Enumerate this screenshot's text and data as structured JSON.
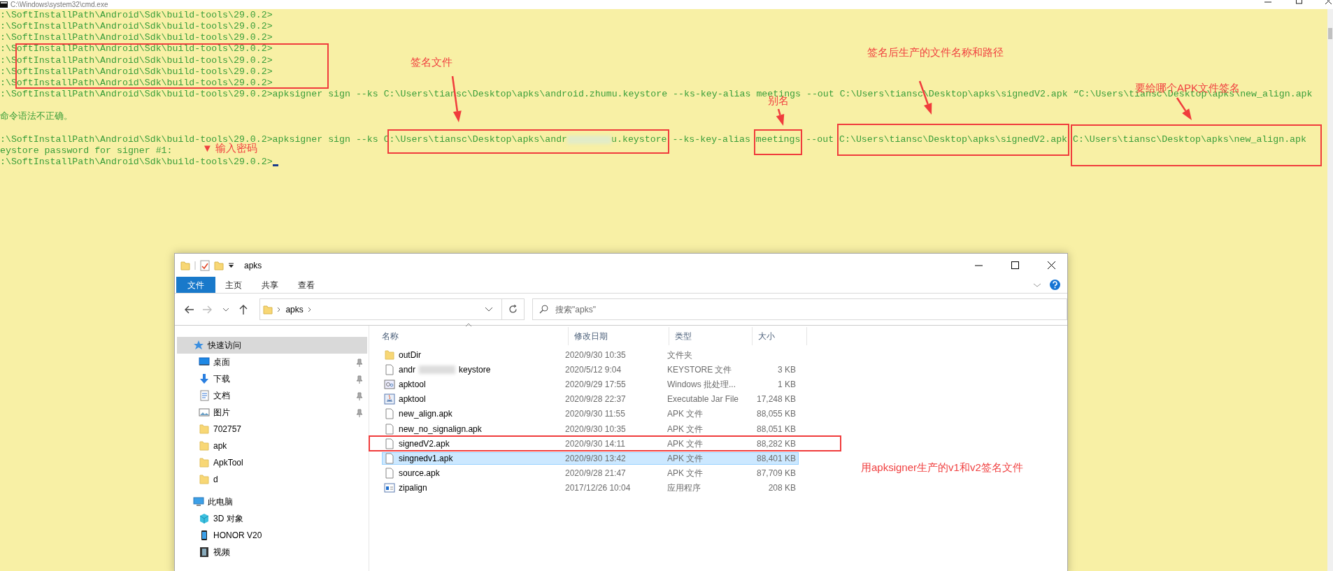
{
  "console_window": {
    "title": "C:\\Windows\\system32\\cmd.exe",
    "blocks": [
      {
        "lines": [
          {
            "text": ":\\SoftInstallPath\\Android\\Sdk\\build-tools\\29.0.2>"
          },
          {
            "text": ":\\SoftInstallPath\\Android\\Sdk\\build-tools\\29.0.2>"
          },
          {
            "text": ":\\SoftInstallPath\\Android\\Sdk\\build-tools\\29.0.2>"
          },
          {
            "text": ":\\SoftInstallPath\\Android\\Sdk\\build-tools\\29.0.2>"
          },
          {
            "text": ":\\SoftInstallPath\\Android\\Sdk\\build-tools\\29.0.2>"
          },
          {
            "text": ":\\SoftInstallPath\\Android\\Sdk\\build-tools\\29.0.2>"
          },
          {
            "text": ":\\SoftInstallPath\\Android\\Sdk\\build-tools\\29.0.2>"
          },
          {
            "text": ":\\SoftInstallPath\\Android\\Sdk\\build-tools\\29.0.2>apksigner sign --ks C:\\Users\\tiansc\\Desktop\\apks\\android.zhumu.keystore --ks-key-alias meetings --out C:\\Users\\tiansc\\Desktop\\apks\\signedV2.apk “C:\\Users\\tiansc\\Desktop\\apks\\new_align.apk"
          }
        ]
      },
      {
        "lines": [
          {
            "text": "命令语法不正确。"
          }
        ]
      },
      {
        "lines": [
          {
            "text_parts": [
              ":\\SoftInstallPath\\Android\\Sdk\\build-tools\\29.0.2>apksigner sign --ks C:\\Users\\tiansc\\Desktop\\apks\\andr",
              "u.keystore --ks-key-alias meetings --out C:\\Users\\tiansc\\Desktop\\apks\\signedV2.apk C:\\Users\\tiansc\\Desktop\\apks\\new_align.apk"
            ]
          },
          {
            "text": "eystore password for signer #1:"
          },
          {
            "text": ":\\SoftInstallPath\\Android\\Sdk\\build-tools\\29.0.2>",
            "cursor": true
          }
        ]
      }
    ]
  },
  "explorer": {
    "title": "apks",
    "ribbon_tabs": [
      {
        "label": "文件",
        "selected": true
      },
      {
        "label": "主页",
        "selected": false
      },
      {
        "label": "共享",
        "selected": false
      },
      {
        "label": "查看",
        "selected": false
      }
    ],
    "address": {
      "segments": [
        "apks"
      ]
    },
    "search": {
      "placeholder": "搜索\"apks\""
    },
    "nav": [
      {
        "label": "快速访问",
        "kind": "star",
        "selected": true,
        "children": [
          {
            "label": "桌面",
            "kind": "desktop",
            "pinned": true,
            "selected": false
          },
          {
            "label": "下载",
            "kind": "download",
            "pinned": true,
            "selected": false
          },
          {
            "label": "文档",
            "kind": "document",
            "pinned": true,
            "selected": false
          },
          {
            "label": "图片",
            "kind": "picture",
            "pinned": true,
            "selected": false
          },
          {
            "label": "702757",
            "kind": "folder",
            "pinned": false,
            "selected": false
          },
          {
            "label": "apk",
            "kind": "folder",
            "pinned": false,
            "selected": false
          },
          {
            "label": "ApkTool",
            "kind": "folder",
            "pinned": false,
            "selected": false
          },
          {
            "label": "d",
            "kind": "folder",
            "pinned": false,
            "selected": false
          }
        ]
      },
      {
        "label": "此电脑",
        "kind": "pc",
        "selected": false,
        "children": [
          {
            "label": "3D 对象",
            "kind": "cube",
            "pinned": false,
            "selected": false
          },
          {
            "label": "HONOR V20",
            "kind": "phone",
            "pinned": false,
            "selected": false
          },
          {
            "label": "视频",
            "kind": "film",
            "pinned": false,
            "selected": false
          }
        ]
      }
    ],
    "columns": [
      "名称",
      "修改日期",
      "类型",
      "大小"
    ],
    "files": [
      {
        "name": "outDir",
        "kind": "folder",
        "date": "2020/9/30 10:35",
        "type": "文件夹",
        "selected": false
      },
      {
        "name_parts": [
          "andr",
          "keystore"
        ],
        "kind": "file",
        "date": "2020/5/12 9:04",
        "type": "KEYSTORE 文件",
        "size": "3 KB",
        "selected": false
      },
      {
        "name": "apktool",
        "kind": "batch",
        "date": "2020/9/29 17:55",
        "type": "Windows 批处理...",
        "size": "1 KB",
        "selected": false
      },
      {
        "name": "apktool",
        "kind": "jar",
        "date": "2020/9/28 22:37",
        "type": "Executable Jar File",
        "size": "17,248 KB",
        "selected": false
      },
      {
        "name": "new_align.apk",
        "kind": "file",
        "date": "2020/9/30 11:55",
        "type": "APK 文件",
        "size": "88,055 KB",
        "selected": false
      },
      {
        "name": "new_no_signalign.apk",
        "kind": "file",
        "date": "2020/9/30 10:35",
        "type": "APK 文件",
        "size": "88,051 KB",
        "selected": false
      },
      {
        "name": "signedV2.apk",
        "kind": "file",
        "date": "2020/9/30 14:11",
        "type": "APK 文件",
        "size": "88,282 KB",
        "selected": false
      },
      {
        "name": "singnedv1.apk",
        "kind": "file",
        "date": "2020/9/30 13:42",
        "type": "APK 文件",
        "size": "88,401 KB",
        "selected": true
      },
      {
        "name": "source.apk",
        "kind": "file",
        "date": "2020/9/28 21:47",
        "type": "APK 文件",
        "size": "87,709 KB",
        "selected": false
      },
      {
        "name": "zipalign",
        "kind": "exe",
        "date": "2017/12/26 10:04",
        "type": "应用程序",
        "size": "208 KB",
        "selected": false
      }
    ]
  },
  "annotations": {
    "labels": [
      "签名文件",
      "别名",
      "签名后生产的文件名称和路径",
      "要给哪个APK文件签名",
      "▼ 输入密码",
      "用apksigner生产的v1和v2签名文件"
    ]
  }
}
